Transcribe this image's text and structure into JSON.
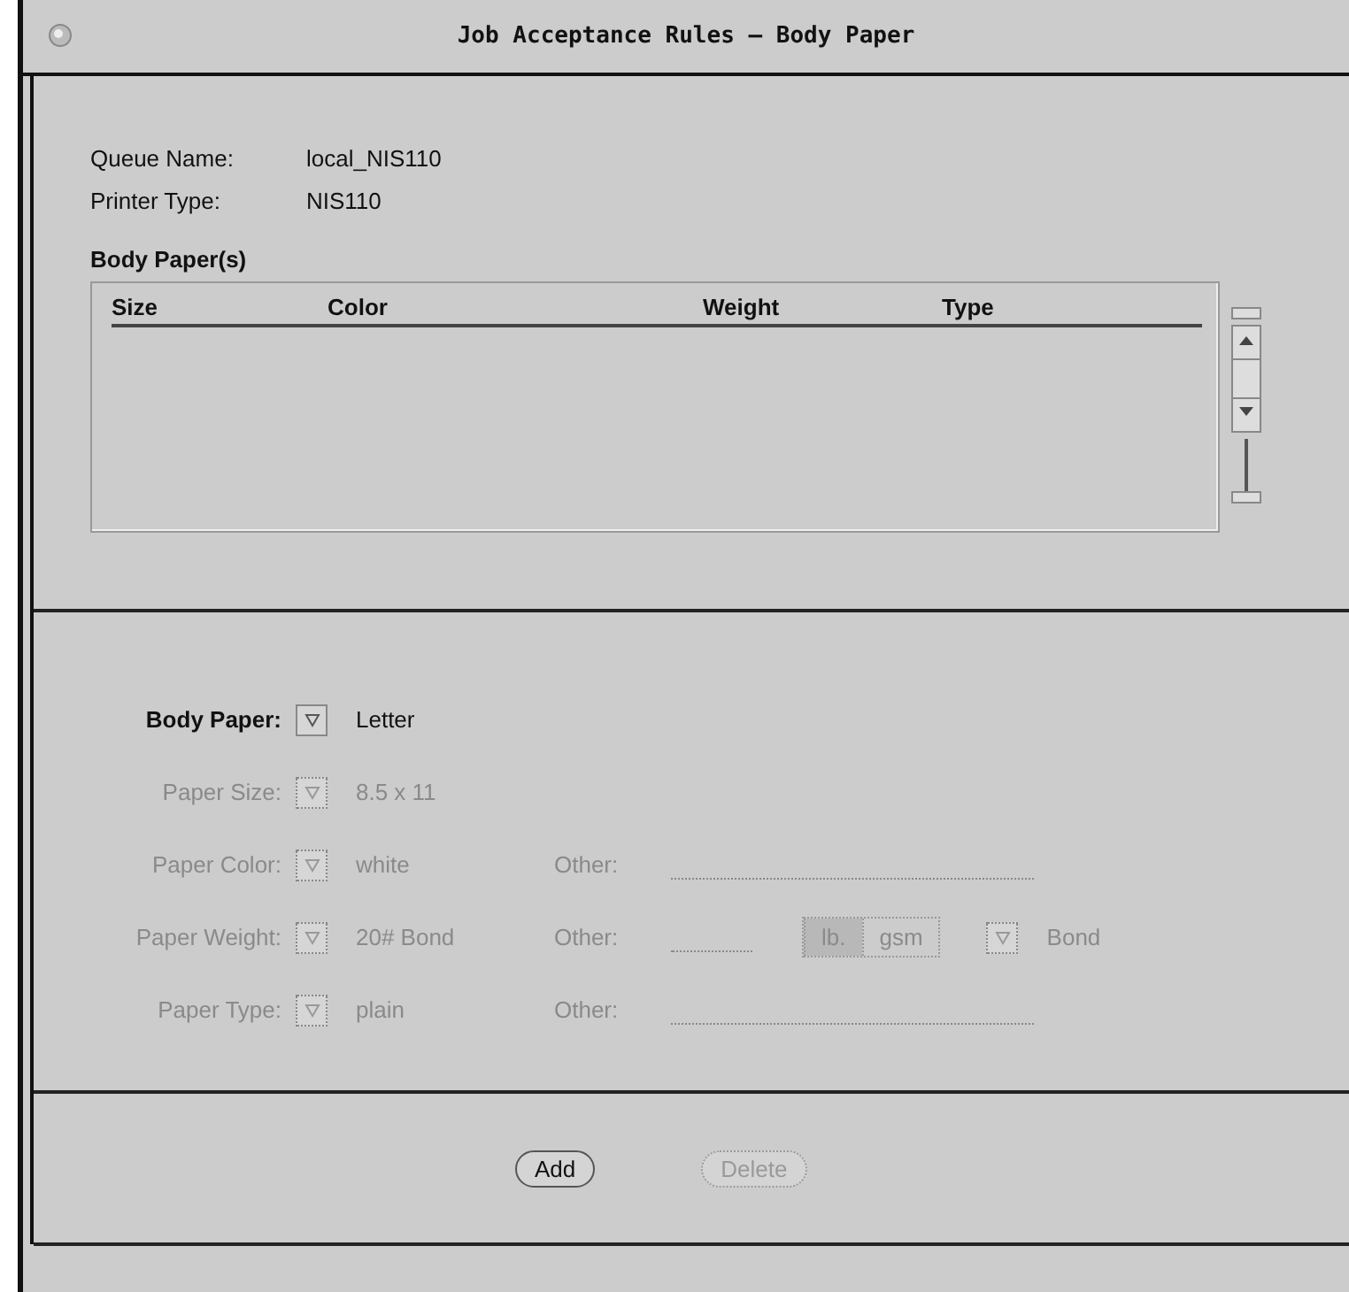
{
  "window": {
    "title": "Job Acceptance Rules – Body Paper"
  },
  "info": [
    {
      "label": "Queue Name:",
      "value": "local_NIS110"
    },
    {
      "label": "Printer Type:",
      "value": "NIS110"
    }
  ],
  "list": {
    "title": "Body Paper(s)",
    "columns": [
      "Size",
      "Color",
      "Weight",
      "Type"
    ]
  },
  "form": [
    {
      "kind": "menu",
      "label": "Body Paper:",
      "value": "Letter",
      "disabled": false
    },
    {
      "kind": "menu",
      "label": "Paper Size:",
      "value": "8.5 x 11",
      "disabled": true
    },
    {
      "kind": "other",
      "label": "Paper Color:",
      "value": "white",
      "other_label": "Other:",
      "disabled": true
    },
    {
      "kind": "weight",
      "label": "Paper Weight:",
      "value": "20# Bond",
      "other_label": "Other:",
      "units": [
        {
          "label": "lb.",
          "selected": true
        },
        {
          "label": "gsm",
          "selected": false
        }
      ],
      "unit_value": "Bond",
      "disabled": true
    },
    {
      "kind": "other",
      "label": "Paper Type:",
      "value": "plain",
      "other_label": "Other:",
      "disabled": true
    }
  ],
  "buttons": [
    {
      "label": "Add",
      "disabled": false
    },
    {
      "label": "Delete",
      "disabled": true
    }
  ]
}
